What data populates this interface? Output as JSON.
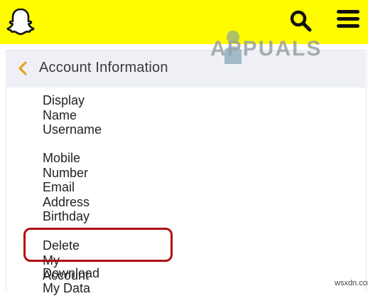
{
  "header": {
    "background_color": "#fffc00",
    "logo_icon": "snapchat-ghost-icon",
    "search_icon": "search-icon",
    "menu_icon": "hamburger-menu-icon"
  },
  "panel": {
    "back_icon": "chevron-left-icon",
    "back_color": "#e8a020",
    "title": "Account Information",
    "items": [
      {
        "label": "Display Name"
      },
      {
        "label": "Username"
      },
      {
        "label": "Mobile Number"
      },
      {
        "label": "Email Address"
      },
      {
        "label": "Birthday"
      },
      {
        "label": "Delete My Account",
        "highlighted": true,
        "highlight_color": "#b01010"
      },
      {
        "label": "Download My Data"
      }
    ]
  },
  "watermark": {
    "text": "APPUALS"
  },
  "credit": {
    "text": "wsxdn.com"
  }
}
